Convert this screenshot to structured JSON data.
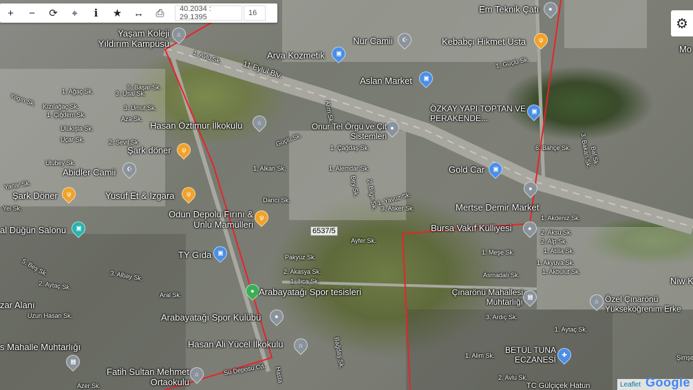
{
  "toolbar": {
    "buttons": [
      {
        "name": "zoom-in-button",
        "icon": "plus-icon",
        "glyph": "+"
      },
      {
        "name": "zoom-out-button",
        "icon": "minus-icon",
        "glyph": "−"
      },
      {
        "name": "refresh-button",
        "icon": "refresh-icon",
        "glyph": "⟳"
      },
      {
        "name": "locate-button",
        "icon": "crosshair-icon",
        "glyph": "⌖"
      },
      {
        "name": "info-button",
        "icon": "info-icon",
        "glyph": "i"
      },
      {
        "name": "favorite-button",
        "icon": "star-icon",
        "glyph": "★"
      },
      {
        "name": "measure-button",
        "icon": "ruler-icon",
        "glyph": "↔"
      },
      {
        "name": "print-button",
        "icon": "printer-icon",
        "glyph": "⎙"
      }
    ],
    "coordinates": "40.2034 : 29.1395",
    "zoom": "16"
  },
  "settings_icon": "⚙",
  "parcel_label": "6537/5",
  "attribution": {
    "leaflet": "Leaflet",
    "google": "Google"
  },
  "colors": {
    "parcel_border": "#e8232a",
    "gear_bg": "#ffffff"
  },
  "pois": [
    {
      "text": "Em Teknik Çatı",
      "type": "gray"
    },
    {
      "text": "Yaşam Koleji Yıldırım Kampüsü",
      "type": "gray"
    },
    {
      "text": "Nur Camii",
      "type": "gray"
    },
    {
      "text": "Kebabçı Hikmet Usta",
      "type": "orange"
    },
    {
      "text": "Arva Kozmetik",
      "type": "blue"
    },
    {
      "text": "Aslan Market",
      "type": "blue"
    },
    {
      "text": "ÖZKAY YAPI TOPTAN VE PERAKENDE...",
      "type": "blue"
    },
    {
      "text": "Hasan Öztimur İlkokulu",
      "type": "gray"
    },
    {
      "text": "Onur Tel Örgü ve Çit Sistemleri",
      "type": "gray"
    },
    {
      "text": "Şark döner",
      "type": "orange"
    },
    {
      "text": "Abidler Camii",
      "type": "gray"
    },
    {
      "text": "Gold Car",
      "type": "blue"
    },
    {
      "text": "Şark Döner",
      "type": "orange"
    },
    {
      "text": "Yusuf Et & Izgara",
      "type": "orange"
    },
    {
      "text": "Mertse Demir Market",
      "type": "gray"
    },
    {
      "text": "Odun Depolu Fırını & Unlu Mamülleri",
      "type": "orange"
    },
    {
      "text": "al Düğün Salonu",
      "type": "teal"
    },
    {
      "text": "Bursa Vakıf Külliyesi",
      "type": "gray"
    },
    {
      "text": "TY Gıda",
      "type": "blue"
    },
    {
      "text": "Arabayatağı Spor tesisleri",
      "type": "green"
    },
    {
      "text": "Çınarönü Mahallesi Muhtarlığı",
      "type": "gray"
    },
    {
      "text": "Özel Çınarönü Yükseköğrenim Erke",
      "type": "gray"
    },
    {
      "text": "Arabayatağı Spor Kulübü",
      "type": "gray"
    },
    {
      "text": "Hasan Ali Yücel İlkokulu",
      "type": "gray"
    },
    {
      "text": "s Mahalle Muhtarlığı",
      "type": "gray"
    },
    {
      "text": "BETÜL TUNA ECZANESİ",
      "type": "blue"
    },
    {
      "text": "Fatih Sultan Mehmet Ortaokulu",
      "type": "gray"
    },
    {
      "text": "zar Alanı",
      "type": "none"
    },
    {
      "text": "Niw K",
      "type": "none"
    },
    {
      "text": "Mo",
      "type": "none"
    },
    {
      "text": "TC Gülçiçek Hatun",
      "type": "none"
    }
  ],
  "streets": [
    "1. Avlu Sk.",
    "11 Eylül Blv.",
    "1. Güçlü Sk.",
    "5. Başar Sk.",
    "1. Ağaç Sk.",
    "3. Usal Sk.",
    "Kızılağaç Sk.",
    "3. Umut Sk.",
    "Yılgın Sk.",
    "1. Çiğdem Sk.",
    "Aza Sk.",
    "Ulukışla Sk.",
    "Uçar Sk.",
    "2. Sevil Sk.",
    "Ulubey Sk.",
    "Yanar Sk.",
    "Yel Sk.",
    "Alım Sk.",
    "Güçlü Sk.",
    "1. Çağdaş Sk.",
    "1. Alkan Sk.",
    "1. Alemdar Sk.",
    "Darıcı Sk.",
    "1. Yavuz Sk.",
    "3. Asker Sk.",
    "Bey Sk.",
    "2. Bilge Sk.",
    "6. Bahçe Sk.",
    "3. Bakan Sk.",
    "Bal Sk.",
    "1. Akdeniz Sk.",
    "2. Aksu Sk.",
    "2. Alp Sk.",
    "1. Meşe Sk.",
    "1. Atilla Sk.",
    "1. Akyuva Sk.",
    "1. Akbulut Sk.",
    "Asmadalı Sk.",
    "Ayfer Sk.",
    "Pakyüz Sk.",
    "1. Ilıca Sk.",
    "2. Akasya Sk.",
    "3. Albay Sk.",
    "2. Aytaç Sk.",
    "5. Beş Sk.",
    "Aral Sk.",
    "Uzun Hasan Sk.",
    "Azer Sk.",
    "3. Ardıç Sk.",
    "1. Aytaç Sk.",
    "1. Alim Sk.",
    "2. Avlu Sk.",
    "Şimşe",
    "Sü Deposu Cd.",
    "Hasta",
    "Bağdaş Sk."
  ]
}
